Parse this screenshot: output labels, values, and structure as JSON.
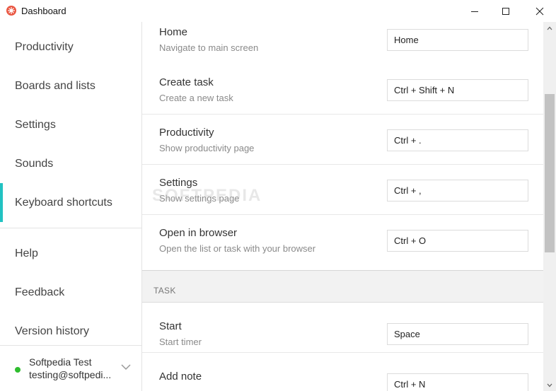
{
  "window": {
    "title": "Dashboard"
  },
  "sidebar": {
    "items": [
      {
        "label": "Productivity"
      },
      {
        "label": "Boards and lists"
      },
      {
        "label": "Settings"
      },
      {
        "label": "Sounds"
      },
      {
        "label": "Keyboard shortcuts"
      }
    ],
    "items2": [
      {
        "label": "Help"
      },
      {
        "label": "Feedback"
      },
      {
        "label": "Version history"
      }
    ],
    "active_item": "Keyboard shortcuts",
    "user": {
      "name": "Softpedia Test",
      "email": "testing@softpedi..."
    }
  },
  "shortcuts": [
    {
      "title": "Home",
      "desc": "Navigate to main screen",
      "key": "Home"
    },
    {
      "title": "Create task",
      "desc": "Create a new task",
      "key": "Ctrl + Shift + N"
    },
    {
      "title": "Productivity",
      "desc": "Show productivity page",
      "key": "Ctrl + ."
    },
    {
      "title": "Settings",
      "desc": "Show settings page",
      "key": "Ctrl + ,"
    },
    {
      "title": "Open in browser",
      "desc": "Open the list or task with your browser",
      "key": "Ctrl + O"
    }
  ],
  "task_section": {
    "label": "TASK",
    "shortcuts": [
      {
        "title": "Start",
        "desc": "Start timer",
        "key": "Space"
      },
      {
        "title": "Add note",
        "desc": "",
        "key": "Ctrl + N"
      }
    ]
  },
  "watermark": "SOFTPEDIA",
  "colors": {
    "accent": "#21c2c2",
    "online": "#2ebd2e",
    "app_icon": "#e9543f"
  },
  "icons": {
    "app": "app-logo-icon",
    "minimize": "minimize-icon",
    "maximize": "maximize-icon",
    "close": "close-icon",
    "chevron": "chevron-down-icon"
  }
}
